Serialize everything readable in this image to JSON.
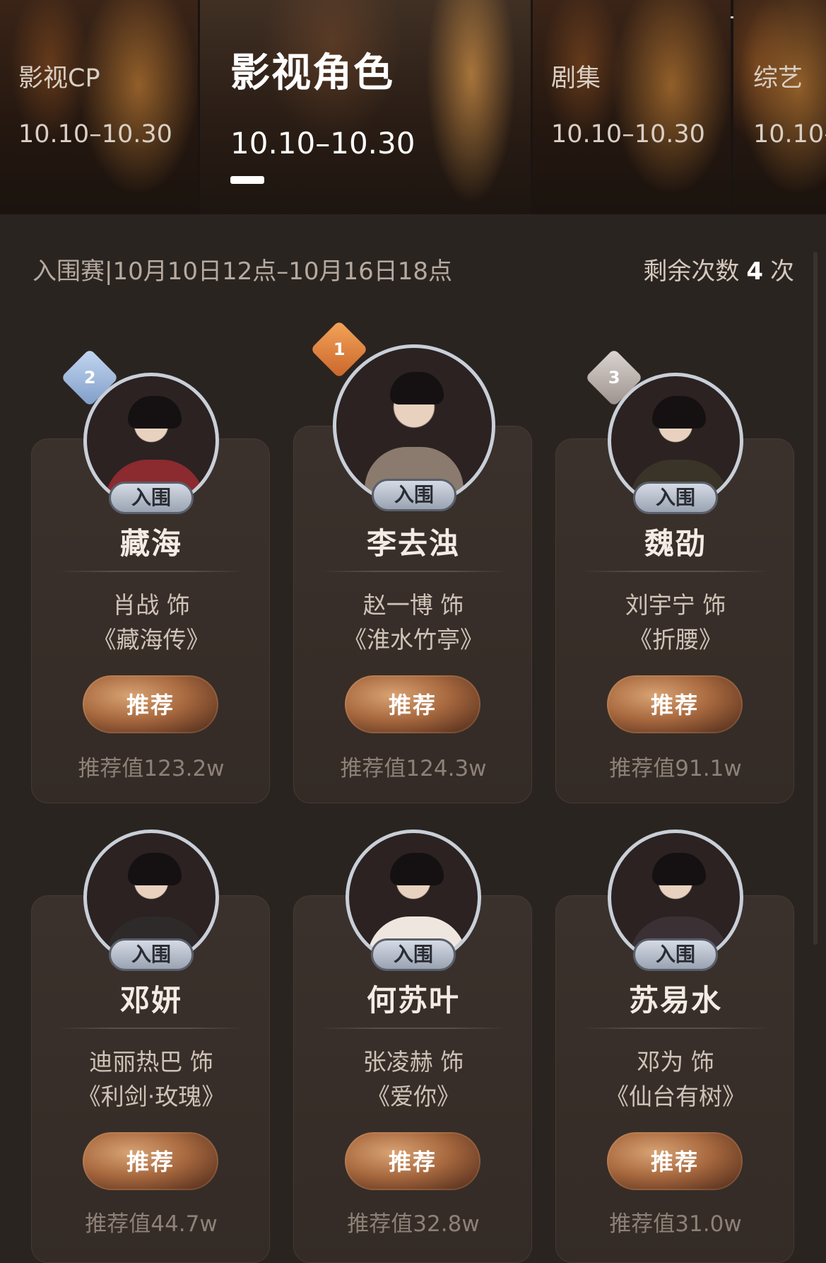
{
  "top_tabs": [
    {
      "title": "影视CP",
      "date": "10.10–10.30",
      "active": false
    },
    {
      "title": "影视角色",
      "date": "10.10–10.30",
      "active": true
    },
    {
      "title": "剧集",
      "date": "10.10–10.30",
      "active": false
    },
    {
      "title": "综艺",
      "date": "10.10–",
      "active": false
    }
  ],
  "info": {
    "stage": "入围赛|10月10日12点–10月16日18点",
    "remaining_label": "剩余次数",
    "remaining_count": "4",
    "remaining_unit": "次"
  },
  "cards": [
    {
      "rank": "2",
      "badge": "入围",
      "role": "藏海",
      "actor": "肖战 饰",
      "show": "《藏海传》",
      "button": "推荐",
      "value": "推荐值123.2w",
      "avatar_color": "#8b2a2f"
    },
    {
      "rank": "1",
      "badge": "入围",
      "role": "李去浊",
      "actor": "赵一博 饰",
      "show": "《淮水竹亭》",
      "button": "推荐",
      "value": "推荐值124.3w",
      "avatar_color": "#8a7b6e"
    },
    {
      "rank": "3",
      "badge": "入围",
      "role": "魏劭",
      "actor": "刘宇宁 饰",
      "show": "《折腰》",
      "button": "推荐",
      "value": "推荐值91.1w",
      "avatar_color": "#3a3428"
    },
    {
      "rank": "",
      "badge": "入围",
      "role": "邓妍",
      "actor": "迪丽热巴 饰",
      "show": "《利剑·玫瑰》",
      "button": "推荐",
      "value": "推荐值44.7w",
      "avatar_color": "#2e2a2a"
    },
    {
      "rank": "",
      "badge": "入围",
      "role": "何苏叶",
      "actor": "张凌赫 饰",
      "show": "《爱你》",
      "button": "推荐",
      "value": "推荐值32.8w",
      "avatar_color": "#efe7df"
    },
    {
      "rank": "",
      "badge": "入围",
      "role": "苏易水",
      "actor": "邓为 饰",
      "show": "《仙台有树》",
      "button": "推荐",
      "value": "推荐值31.0w",
      "avatar_color": "#3b3033"
    }
  ]
}
